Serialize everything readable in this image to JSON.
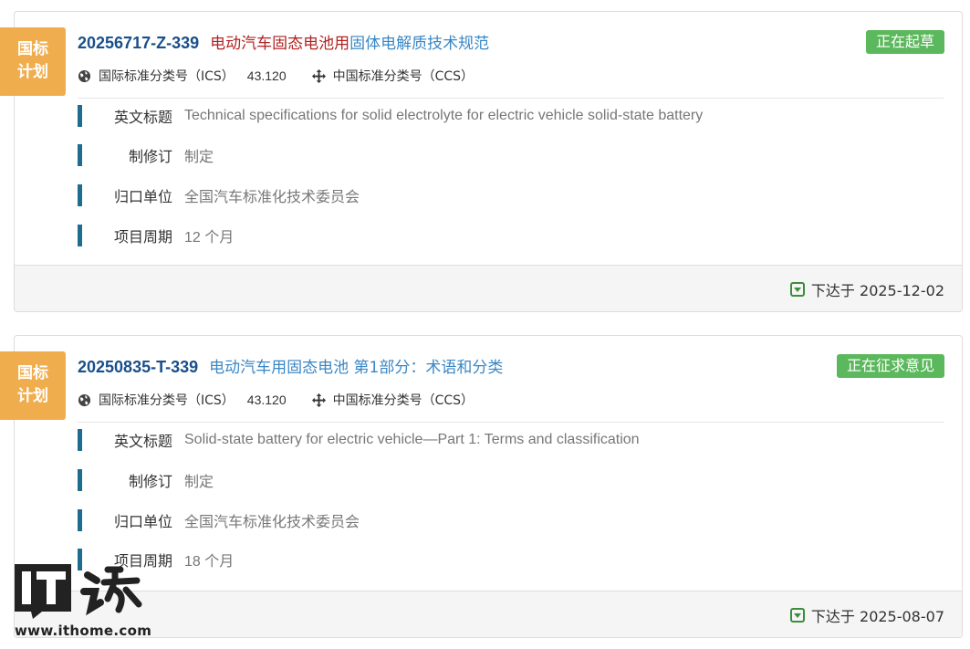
{
  "colors": {
    "ribbon": "#f0ad4e",
    "status": "#5cb85c",
    "code": "#1a4f8b",
    "name_red": "#b22222",
    "name_blue": "#3a87c5",
    "bar": "#1e6d8f"
  },
  "cards": [
    {
      "ribbon": [
        "国标",
        "计划"
      ],
      "code": "20256717-Z-339",
      "name_red": "电动汽车固态电池用",
      "name_blue": "固体电解质技术规范",
      "status": "正在起草",
      "ics_label": "国际标准分类号（ICS）",
      "ics_value": "43.120",
      "ccs_label": "中国标准分类号（CCS）",
      "fields": [
        {
          "label": "英文标题",
          "value": "Technical specifications for solid electrolyte for electric vehicle solid-state battery"
        },
        {
          "label": "制修订",
          "value": "制定"
        },
        {
          "label": "归口单位",
          "value": "全国汽车标准化技术委员会"
        },
        {
          "label": "项目周期",
          "value": "12 个月"
        }
      ],
      "issued": "下达于 2025-12-02"
    },
    {
      "ribbon": [
        "国标",
        "计划"
      ],
      "code": "20250835-T-339",
      "name_blue": "电动汽车用固态电池 第1部分：术语和分类",
      "status": "正在征求意见",
      "ics_label": "国际标准分类号（ICS）",
      "ics_value": "43.120",
      "ccs_label": "中国标准分类号（CCS）",
      "fields": [
        {
          "label": "英文标题",
          "value": "Solid-state battery for electric vehicle—Part 1: Terms and classification"
        },
        {
          "label": "制修订",
          "value": "制定"
        },
        {
          "label": "归口单位",
          "value": "全国汽车标准化技术委员会"
        },
        {
          "label": "项目周期",
          "value": "18 个月"
        }
      ],
      "issued": "下达于 2025-08-07"
    }
  ],
  "watermark": {
    "logo_text": "IT之家",
    "url": "www.ithome.com"
  },
  "icons": {
    "globe": "globe-icon",
    "ccs": "move-arrows-icon",
    "issued": "calendar-down-icon"
  }
}
